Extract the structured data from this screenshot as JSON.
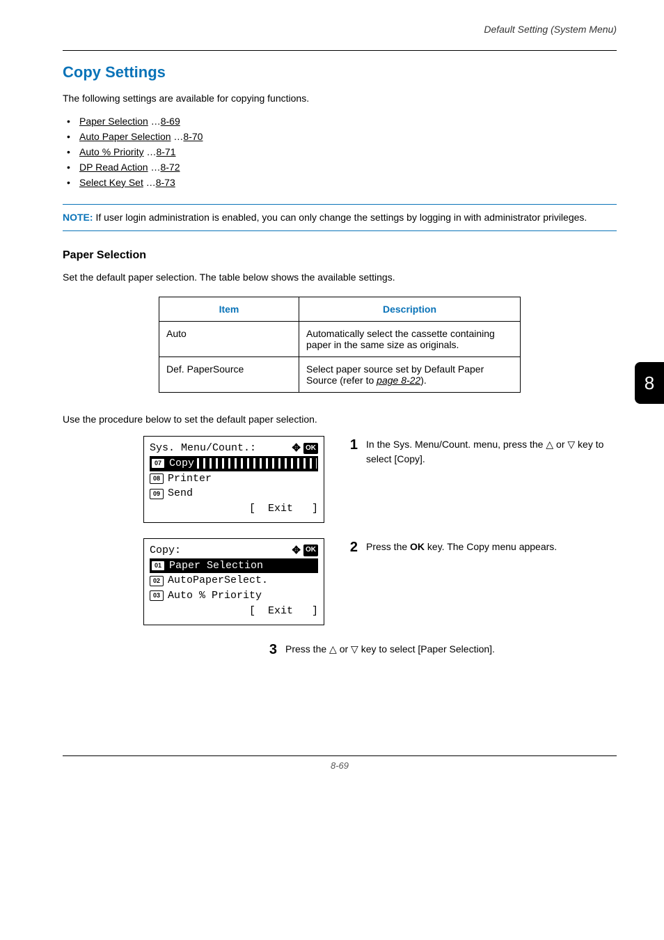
{
  "header": {
    "breadcrumb": "Default Setting (System Menu)"
  },
  "section_title": "Copy Settings",
  "intro": "The following settings are available for copying functions.",
  "links": [
    {
      "label": "Paper Selection",
      "page": "8-69"
    },
    {
      "label": "Auto Paper Selection",
      "page": "8-70"
    },
    {
      "label": "Auto % Priority",
      "page": "8-71"
    },
    {
      "label": "DP Read Action",
      "page": "8-72"
    },
    {
      "label": "Select Key Set",
      "page": "8-73"
    }
  ],
  "note": {
    "label": "NOTE:",
    "text": " If user login administration is enabled, you can only change the settings by logging in with administrator privileges."
  },
  "subheading": "Paper Selection",
  "subintro": "Set the default paper selection. The table below shows the available settings.",
  "table": {
    "headers": {
      "item": "Item",
      "desc": "Description"
    },
    "rows": [
      {
        "item": "Auto",
        "desc": "Automatically select the cassette containing paper in the same size as originals."
      },
      {
        "item": "Def. PaperSource",
        "desc_pre": "Select paper source set by Default Paper Source (refer to ",
        "desc_link": "page 8-22",
        "desc_post": ")."
      }
    ]
  },
  "procedure_intro": "Use the procedure below to set the default paper selection.",
  "lcd1": {
    "title": "Sys. Menu/Count.:",
    "ok": "OK",
    "rows": [
      {
        "num": "07",
        "label": "Copy",
        "selected": true,
        "hatched": true
      },
      {
        "num": "08",
        "label": "Printer"
      },
      {
        "num": "09",
        "label": "Send"
      }
    ],
    "exit": "[  Exit   ]"
  },
  "lcd2": {
    "title": "Copy:",
    "ok": "OK",
    "rows": [
      {
        "num": "01",
        "label": "Paper Selection",
        "selected": true
      },
      {
        "num": "02",
        "label": "AutoPaperSelect."
      },
      {
        "num": "03",
        "label": "Auto % Priority"
      }
    ],
    "exit": "[  Exit   ]"
  },
  "steps": {
    "s1": {
      "num": "1",
      "pre": "In the Sys. Menu/Count. menu, press the ",
      "tri1": "△",
      "mid": " or ",
      "tri2": "▽",
      "post": " key to select [Copy]."
    },
    "s2": {
      "num": "2",
      "pre": "Press the ",
      "bold": "OK",
      "post": " key. The Copy menu appears."
    },
    "s3": {
      "num": "3",
      "pre": "Press the ",
      "tri1": "△",
      "mid": " or ",
      "tri2": "▽",
      "post": " key to select [Paper Selection]."
    }
  },
  "sidetab": "8",
  "footer": "8-69"
}
